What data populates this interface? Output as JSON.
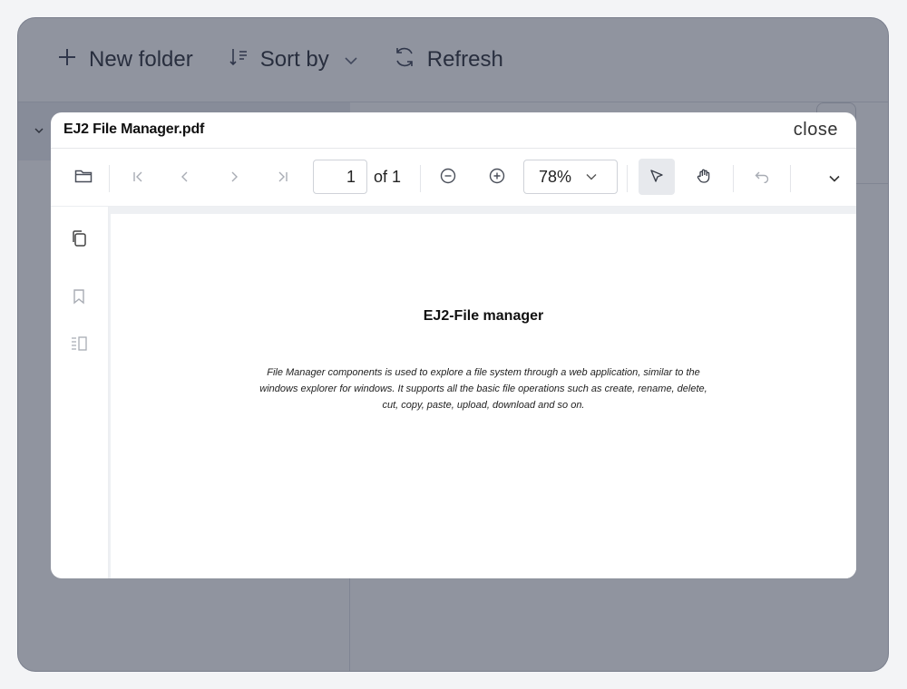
{
  "file_manager": {
    "toolbar": {
      "new_folder": "New folder",
      "sort_by": "Sort by",
      "refresh": "Refresh"
    }
  },
  "dialog": {
    "title": "EJ2 File Manager.pdf",
    "close_label": "close"
  },
  "pdf_toolbar": {
    "page_number": "1",
    "page_total": "of 1",
    "zoom": "78%"
  },
  "document": {
    "heading": "EJ2-File manager",
    "body_lines": [
      "File Manager components is used to explore a file system through a web application, similar to the",
      "windows explorer for windows. It supports all the basic file operations such as create, rename, delete,",
      "cut, copy, paste, upload, download and so on."
    ]
  },
  "icons": {
    "toolbar": [
      "plus-icon",
      "sort-icon",
      "chevron-down-icon",
      "refresh-icon"
    ],
    "pdf": [
      "folder-open-icon",
      "first-page-icon",
      "previous-page-icon",
      "next-page-icon",
      "last-page-icon",
      "zoom-out-icon",
      "zoom-in-icon",
      "selection-tool-icon",
      "pan-tool-icon",
      "undo-icon",
      "more-options-icon"
    ],
    "side": [
      "page-thumbnails-icon",
      "bookmark-icon",
      "organize-pages-icon"
    ]
  },
  "colors": {
    "overlay": "#141c32",
    "active_tool": "#e7e9ed"
  }
}
